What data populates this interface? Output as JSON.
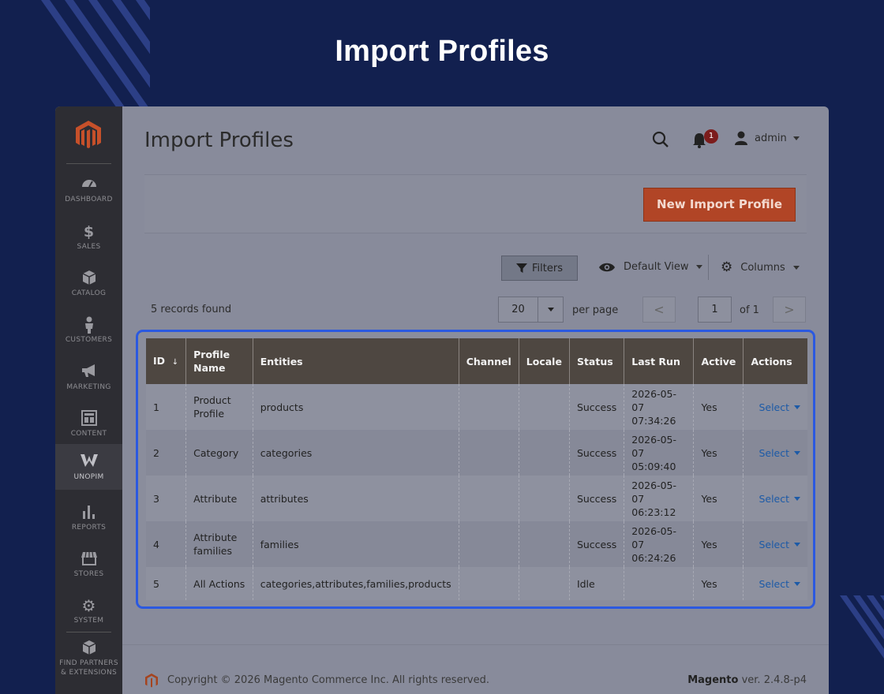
{
  "banner": {
    "title": "Import Profiles"
  },
  "sidebar": {
    "items": [
      {
        "label": "DASHBOARD",
        "icon": "dashboard-icon"
      },
      {
        "label": "SALES",
        "icon": "dollar-icon"
      },
      {
        "label": "CATALOG",
        "icon": "cube-icon"
      },
      {
        "label": "CUSTOMERS",
        "icon": "person-icon"
      },
      {
        "label": "MARKETING",
        "icon": "megaphone-icon"
      },
      {
        "label": "CONTENT",
        "icon": "layout-icon"
      },
      {
        "label": "UNOPIM",
        "icon": "unopim-icon"
      },
      {
        "label": "REPORTS",
        "icon": "bar-chart-icon"
      },
      {
        "label": "STORES",
        "icon": "store-icon"
      },
      {
        "label": "SYSTEM",
        "icon": "gear-icon"
      },
      {
        "label1": "FIND PARTNERS",
        "label2": "& EXTENSIONS",
        "icon": "box-icon"
      }
    ],
    "active": "UNOPIM"
  },
  "header": {
    "title": "Import Profiles",
    "notification_count": "1",
    "user": "admin"
  },
  "actions": {
    "new_button": "New Import Profile"
  },
  "toolbar": {
    "filters": "Filters",
    "view": "Default View",
    "columns": "Columns"
  },
  "pager": {
    "records": "5 records found",
    "per_page_value": "20",
    "per_page_label": "per page",
    "prev": "<",
    "next": ">",
    "page": "1",
    "of": "of 1"
  },
  "grid": {
    "columns": [
      "ID",
      "Profile Name",
      "Entities",
      "Channel",
      "Locale",
      "Status",
      "Last Run",
      "Active",
      "Actions"
    ],
    "sort_indicator": "↓",
    "rows": [
      {
        "id": "1",
        "name": "Product Profile",
        "entities": "products",
        "channel": "",
        "locale": "",
        "status": "Success",
        "last_run": "2026-05-07 07:34:26",
        "active": "Yes",
        "action": "Select"
      },
      {
        "id": "2",
        "name": "Category",
        "entities": "categories",
        "channel": "",
        "locale": "",
        "status": "Success",
        "last_run": "2026-05-07 05:09:40",
        "active": "Yes",
        "action": "Select"
      },
      {
        "id": "3",
        "name": "Attribute",
        "entities": "attributes",
        "channel": "",
        "locale": "",
        "status": "Success",
        "last_run": "2026-05-07 06:23:12",
        "active": "Yes",
        "action": "Select"
      },
      {
        "id": "4",
        "name": "Attribute families",
        "entities": "families",
        "channel": "",
        "locale": "",
        "status": "Success",
        "last_run": "2026-05-07 06:24:26",
        "active": "Yes",
        "action": "Select"
      },
      {
        "id": "5",
        "name": "All Actions",
        "entities": "categories,attributes,families,products",
        "channel": "",
        "locale": "",
        "status": "Idle",
        "last_run": "",
        "active": "Yes",
        "action": "Select"
      }
    ]
  },
  "footer": {
    "copyright": "Copyright © 2026 Magento Commerce Inc. All rights reserved.",
    "brand": "Magento",
    "version": "ver. 2.4.8-p4"
  },
  "colors": {
    "background": "#12204f",
    "accent_button": "#b14526",
    "highlight_border": "#2b59e0",
    "sidebar": "#2d2d33",
    "grid_header": "#4e4741",
    "link": "#1c5aa7"
  }
}
